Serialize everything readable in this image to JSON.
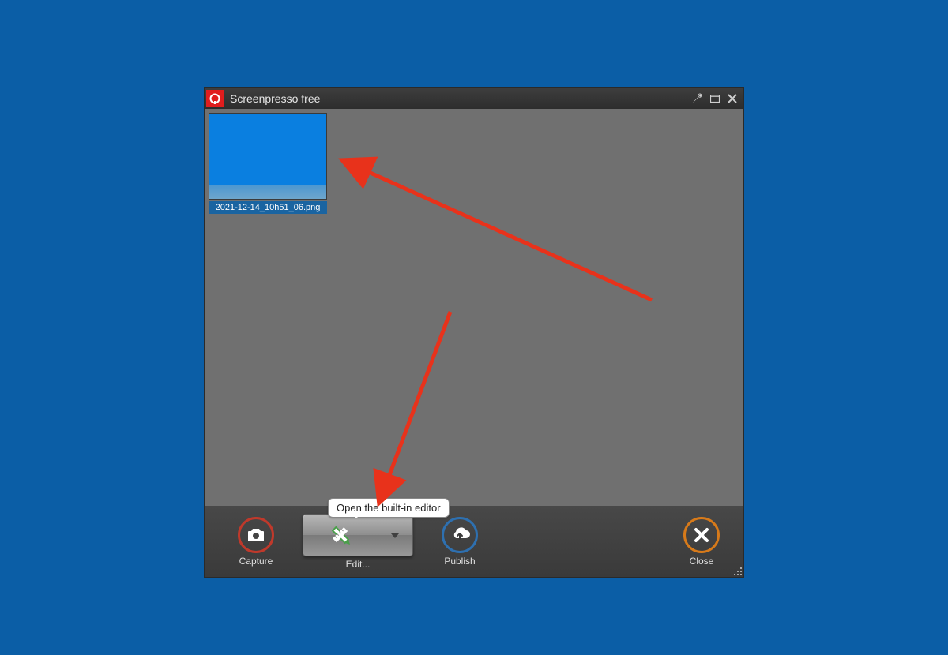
{
  "window": {
    "title": "Screenpresso free"
  },
  "thumbnail": {
    "filename": "2021-12-14_10h51_06.png"
  },
  "toolbar": {
    "capture_label": "Capture",
    "edit_label": "Edit...",
    "publish_label": "Publish",
    "close_label": "Close"
  },
  "tooltip": {
    "edit_button": "Open the built-in editor"
  },
  "icons": {
    "logo": "screenpresso-logo",
    "settings": "wrench-icon",
    "maximize": "maximize-icon",
    "close": "close-icon",
    "camera": "camera-icon",
    "edit": "pencil-ruler-icon",
    "caret": "caret-down-icon",
    "publish": "cloud-upload-icon",
    "x": "x-icon"
  },
  "colors": {
    "desktop": "#0b5ea6",
    "capture_ring": "#c0392b",
    "publish_ring": "#2e70b0",
    "close_ring": "#d77a1a",
    "annotation_arrow": "#e8321b"
  }
}
